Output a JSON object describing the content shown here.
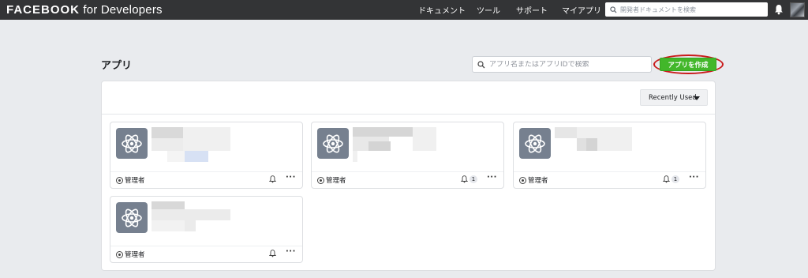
{
  "topbar": {
    "brand_strong": "FACEBOOK",
    "brand_rest": " for Developers",
    "nav": [
      "ドキュメント",
      "ツール",
      "サポート",
      "マイアプリ"
    ],
    "search_placeholder": "開発者ドキュメントを検索"
  },
  "page": {
    "title": "アプリ",
    "search_placeholder": "アプリ名またはアプリIDで検索",
    "create_button": "アプリを作成",
    "sort_label": "Recently Used"
  },
  "apps": [
    {
      "role": "管理者",
      "notifications": ""
    },
    {
      "role": "管理者",
      "notifications": "1"
    },
    {
      "role": "管理者",
      "notifications": "1"
    },
    {
      "role": "管理者",
      "notifications": ""
    }
  ],
  "icons": {
    "search": "search-icon",
    "bell": "bell-icon",
    "app": "atom-icon",
    "shield": "shield-icon",
    "more": "more-icon",
    "caret": "caret-down-icon"
  },
  "colors": {
    "topbar": "#333436",
    "background": "#e9ebee",
    "create_button": "#42b72a",
    "highlight_ring": "#c91b1b",
    "app_icon_bg": "#76808f"
  }
}
